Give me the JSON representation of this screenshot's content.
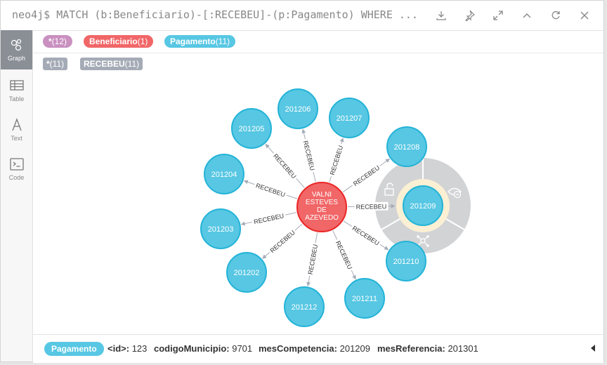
{
  "query": "MATCH (b:Beneficiario)-[:RECEBEU]-(p:Pagamento) WHERE ...",
  "prompt": "neo4j$",
  "toolbar": [
    "download-icon",
    "pin-icon",
    "expand-icon",
    "collapse-icon",
    "refresh-icon",
    "close-icon"
  ],
  "sidebar": [
    {
      "label": "Graph",
      "icon": "graph-icon",
      "active": true
    },
    {
      "label": "Table",
      "icon": "table-icon",
      "active": false
    },
    {
      "label": "Text",
      "icon": "text-icon",
      "active": false
    },
    {
      "label": "Code",
      "icon": "code-icon",
      "active": false
    }
  ],
  "node_labels": [
    {
      "name": "*",
      "count": "(12)",
      "color": "#c990c0"
    },
    {
      "name": "Beneficiario",
      "count": "(1)",
      "color": "#f16667"
    },
    {
      "name": "Pagamento",
      "count": "(11)",
      "color": "#57c7e3"
    }
  ],
  "rel_types": [
    {
      "name": "*",
      "count": "(11)"
    },
    {
      "name": "RECEBEU",
      "count": "(11)"
    }
  ],
  "graph": {
    "center": {
      "label_lines": [
        "VALNI",
        "ESTEVES",
        "DE",
        "AZEVEDO"
      ],
      "color": "#f16667"
    },
    "edge_label": "RECEBEU",
    "nodes": [
      {
        "id": "201206"
      },
      {
        "id": "201207"
      },
      {
        "id": "201205"
      },
      {
        "id": "201208"
      },
      {
        "id": "201204"
      },
      {
        "id": "201209",
        "selected": true
      },
      {
        "id": "201203"
      },
      {
        "id": "201202"
      },
      {
        "id": "201210"
      },
      {
        "id": "201212"
      },
      {
        "id": "201211"
      }
    ],
    "node_color": "#57c7e3",
    "ring_actions": [
      "unlock-icon",
      "hide-icon",
      "expand-graph-icon"
    ]
  },
  "status": {
    "label": "Pagamento",
    "props": [
      {
        "key": "<id>:",
        "value": "123"
      },
      {
        "key": "codigoMunicipio:",
        "value": "9701"
      },
      {
        "key": "mesCompetencia:",
        "value": "201209"
      },
      {
        "key": "mesReferencia:",
        "value": "201301"
      }
    ]
  }
}
